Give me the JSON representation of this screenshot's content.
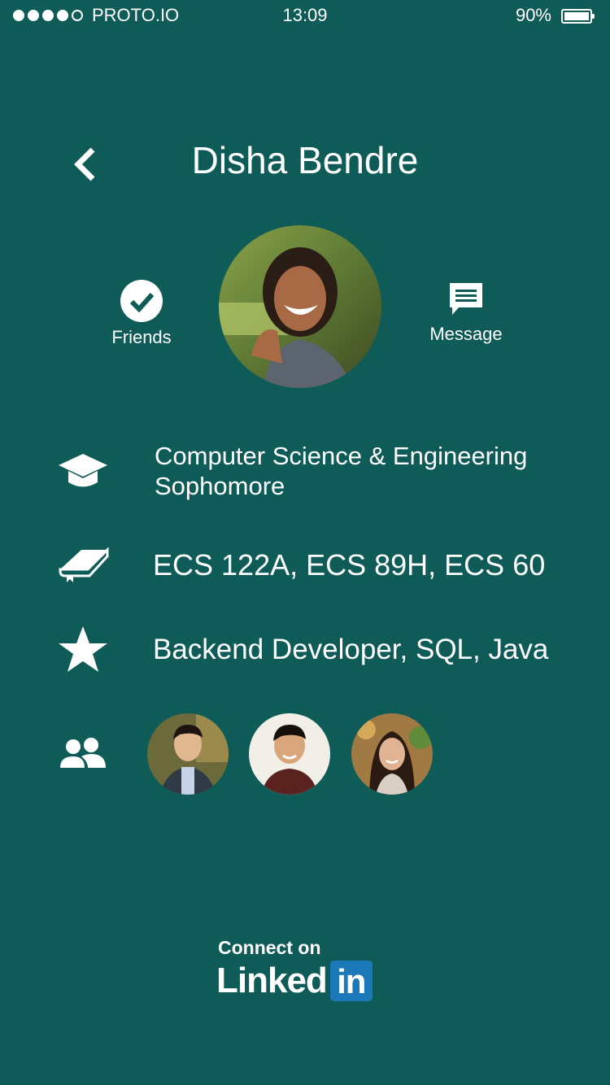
{
  "status_bar": {
    "carrier": "PROTO.IO",
    "signal_bars": 4,
    "signal_total": 5,
    "time": "13:09",
    "battery_text": "90%",
    "battery_level": 0.9
  },
  "header": {
    "back_icon": "chevron-left-icon",
    "name": "Disha Bendre"
  },
  "profile": {
    "friends": {
      "label": "Friends",
      "icon": "check-circle-icon"
    },
    "message": {
      "label": "Message",
      "icon": "chat-bubble-icon"
    }
  },
  "details": {
    "major": "Computer Science & Engineering",
    "year": "Sophomore",
    "courses": "ECS 122A, ECS 89H, ECS 60",
    "skills": "Backend Developer, SQL, Java"
  },
  "footer": {
    "connect_text": "Connect on",
    "linkedin_word": "Linked",
    "linkedin_box": "in"
  },
  "colors": {
    "background": "#0e5b57",
    "linkedin_blue": "#1b79b9",
    "text": "#ffffff"
  }
}
